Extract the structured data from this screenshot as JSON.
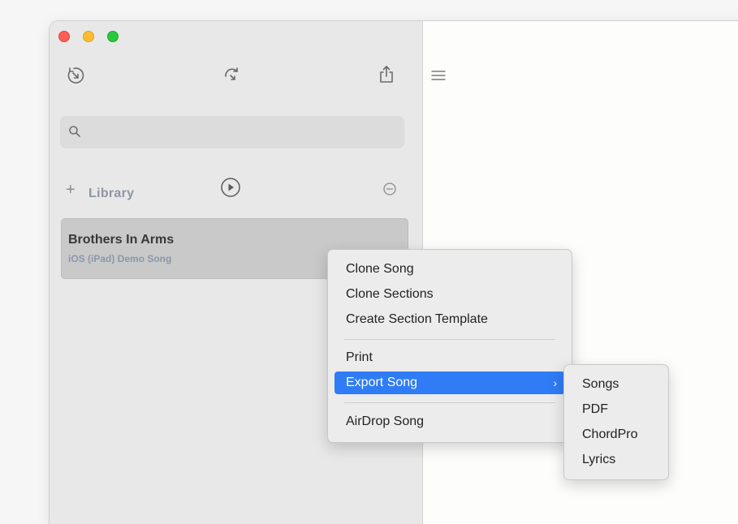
{
  "search": {
    "placeholder": ""
  },
  "library": {
    "label": "Library"
  },
  "song": {
    "title": "Brothers In Arms",
    "subtitle": "iOS (iPad) Demo Song"
  },
  "context_menu": {
    "items": [
      {
        "label": "Clone Song"
      },
      {
        "label": "Clone Sections"
      },
      {
        "label": "Create Section Template"
      },
      {
        "label": "Print"
      },
      {
        "label": "Export Song",
        "active": true
      },
      {
        "label": "AirDrop Song"
      }
    ]
  },
  "export_submenu": {
    "items": [
      {
        "label": "Songs"
      },
      {
        "label": "PDF"
      },
      {
        "label": "ChordPro"
      },
      {
        "label": "Lyrics"
      }
    ]
  },
  "colors": {
    "highlight": "#2f7cf6",
    "sidebar_bg": "#e8e8e8",
    "library_label": "#8e96a6",
    "close": "#fe5f57",
    "minimize": "#febc2e",
    "zoom": "#28c840"
  },
  "icons": [
    "undo-history-icon",
    "redo-icon",
    "share-icon",
    "search-icon",
    "plus-icon",
    "play-circle-icon",
    "minus-circle-icon",
    "hamburger-icon",
    "chevron-right-icon"
  ]
}
